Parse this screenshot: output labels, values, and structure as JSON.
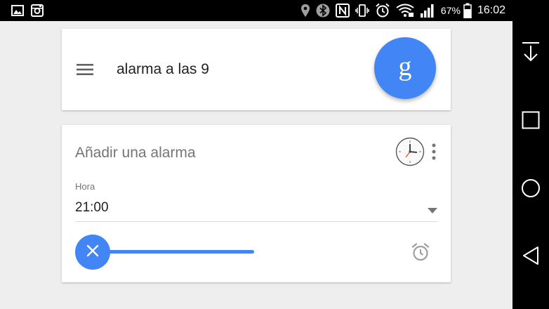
{
  "status_bar": {
    "battery_percent": "67%",
    "time": "16:02",
    "icons_left": [
      "gallery-icon",
      "instagram-icon"
    ],
    "icons_right": [
      "location-icon",
      "bluetooth-icon",
      "nfc-icon",
      "vibrate-icon",
      "alarm-clock-icon",
      "wifi-icon",
      "signal-icon",
      "battery-icon"
    ]
  },
  "search": {
    "query": "alarma a las 9",
    "voice_button_glyph": "g"
  },
  "alarm_card": {
    "title": "Añadir una alarma",
    "field_label": "Hora",
    "time_value": "21:00"
  },
  "colors": {
    "accent": "#4285f4",
    "background": "#eeeeee",
    "card": "#ffffff",
    "text_primary": "#212121",
    "text_secondary": "#757575"
  },
  "nav_bar": {
    "buttons": [
      "download-icon",
      "recents-icon",
      "home-icon",
      "back-icon"
    ]
  }
}
